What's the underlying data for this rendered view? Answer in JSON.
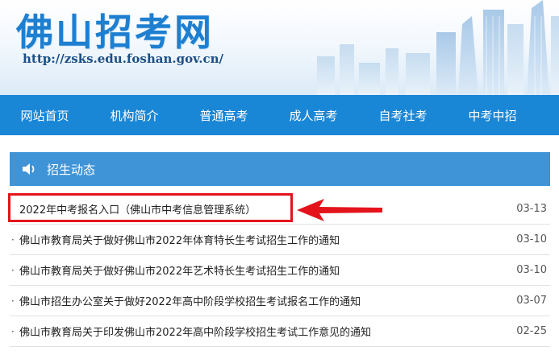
{
  "header": {
    "title": "佛山招考网",
    "url": "http://zsks.edu.foshan.gov.cn/"
  },
  "nav": {
    "items": [
      "网站首页",
      "机构简介",
      "普通高考",
      "成人高考",
      "自考社考",
      "中考中招"
    ]
  },
  "section": {
    "title": "招生动态",
    "icon": "speaker-icon"
  },
  "news": [
    {
      "bullet": "",
      "title": "2022年中考报名入口（佛山市中考信息管理系统）",
      "date": "03-13"
    },
    {
      "bullet": "·",
      "title": "佛山市教育局关于做好佛山市2022年体育特长生考试招生工作的通知",
      "date": "03-10"
    },
    {
      "bullet": "·",
      "title": "佛山市教育局关于做好佛山市2022年艺术特长生考试招生工作的通知",
      "date": "03-10"
    },
    {
      "bullet": "·",
      "title": "佛山市招生办公室关于做好2022年高中阶段学校招生考试报名工作的通知",
      "date": "03-07"
    },
    {
      "bullet": "·",
      "title": "佛山市教育局关于印发佛山市2022年高中阶段学校招生考试工作意见的通知",
      "date": "02-25"
    }
  ],
  "colors": {
    "brand": "#1e7fd0",
    "nav": "#1a86d6",
    "section_header": "#3f94d8",
    "annotation": "#e3141c"
  }
}
